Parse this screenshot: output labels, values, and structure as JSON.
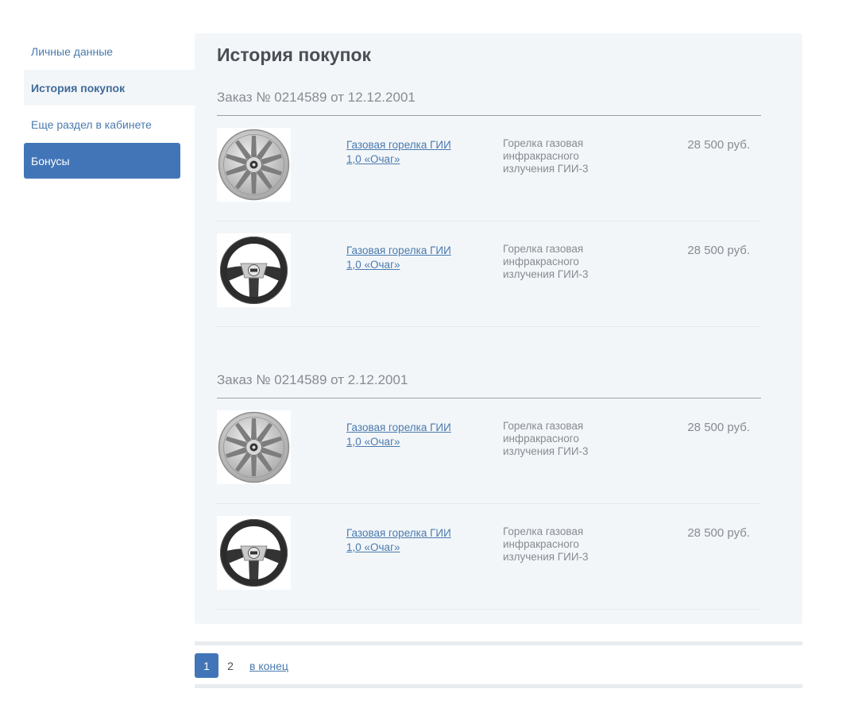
{
  "sidebar": {
    "items": [
      {
        "label": "Личные данные"
      },
      {
        "label": "История покупок"
      },
      {
        "label": "Еще раздел в кабинете"
      },
      {
        "label": "Бонусы"
      }
    ]
  },
  "main": {
    "title": "История покупок",
    "orders": [
      {
        "title": "Заказ № 0214589 от 12.12.2001",
        "items": [
          {
            "icon": "wheel-cap-icon",
            "link": "Газовая горелка ГИИ 1,0 «Очаг»",
            "desc": "Горелка газовая инфракрасного излучения ГИИ-3",
            "price": "28 500 руб."
          },
          {
            "icon": "steering-wheel-icon",
            "link": "Газовая горелка ГИИ 1,0 «Очаг»",
            "desc": "Горелка газовая инфракрасного излучения ГИИ-3",
            "price": "28 500 руб."
          }
        ]
      },
      {
        "title": "Заказ № 0214589 от 2.12.2001",
        "items": [
          {
            "icon": "wheel-cap-icon",
            "link": "Газовая горелка ГИИ 1,0 «Очаг»",
            "desc": "Горелка газовая инфракрасного излучения ГИИ-3",
            "price": "28 500 руб."
          },
          {
            "icon": "steering-wheel-icon",
            "link": "Газовая горелка ГИИ 1,0 «Очаг»",
            "desc": "Горелка газовая инфракрасного излучения ГИИ-3",
            "price": "28 500 руб."
          }
        ]
      }
    ]
  },
  "pagination": {
    "current": "1",
    "next": "2",
    "end_label": "в конец"
  },
  "colors": {
    "accent": "#4275b8",
    "link": "#4a7aae",
    "panel_bg": "#f3f6f9"
  }
}
